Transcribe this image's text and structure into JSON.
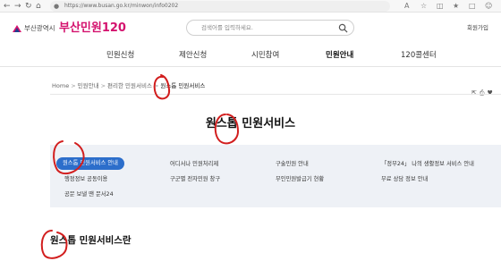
{
  "browser": {
    "url": "https://www.busan.go.kr/minwon/info0202"
  },
  "header": {
    "city_name": "부산광역시",
    "site_name": "부산민원120",
    "search_placeholder": "검색어를 입력하세요.",
    "join_label": "회원가입"
  },
  "gnb": {
    "items": [
      {
        "label": "민원신청"
      },
      {
        "label": "제안신청"
      },
      {
        "label": "시민참여"
      },
      {
        "label": "민원안내",
        "active": true
      },
      {
        "label": "120콜센터"
      }
    ]
  },
  "breadcrumb": {
    "items": [
      "Home",
      "민원안내",
      "편리한 민원서비스",
      "원스톱 민원서비스"
    ]
  },
  "page": {
    "title": "원스톱 민원서비스",
    "section_title": "원스톱 민원서비스란"
  },
  "tabs": {
    "items": [
      {
        "label": "원스톱 민원서비스 안내",
        "active": true
      },
      {
        "label": "어디서나 민원처리제"
      },
      {
        "label": "구술민원 안내"
      },
      {
        "label": "「정부24」 나의 생활정보 서비스 안내"
      },
      {
        "label": "행정정보 공동이용"
      },
      {
        "label": "구군별 전자민원 창구"
      },
      {
        "label": "무인민원발급기 현황"
      },
      {
        "label": "무료 상담 정보 안내"
      },
      {
        "label": "공문 보낼 땐 문서24"
      }
    ]
  },
  "colors": {
    "brand": "#d4126e",
    "active_tab": "#2c6ecb",
    "tab_bg": "#eef1f6",
    "annotation": "#d21e1e"
  },
  "icons": [
    "back-icon",
    "forward-icon",
    "reload-icon",
    "home-icon",
    "lock-icon",
    "search-icon",
    "print-icon",
    "share-icon",
    "heart-icon"
  ]
}
